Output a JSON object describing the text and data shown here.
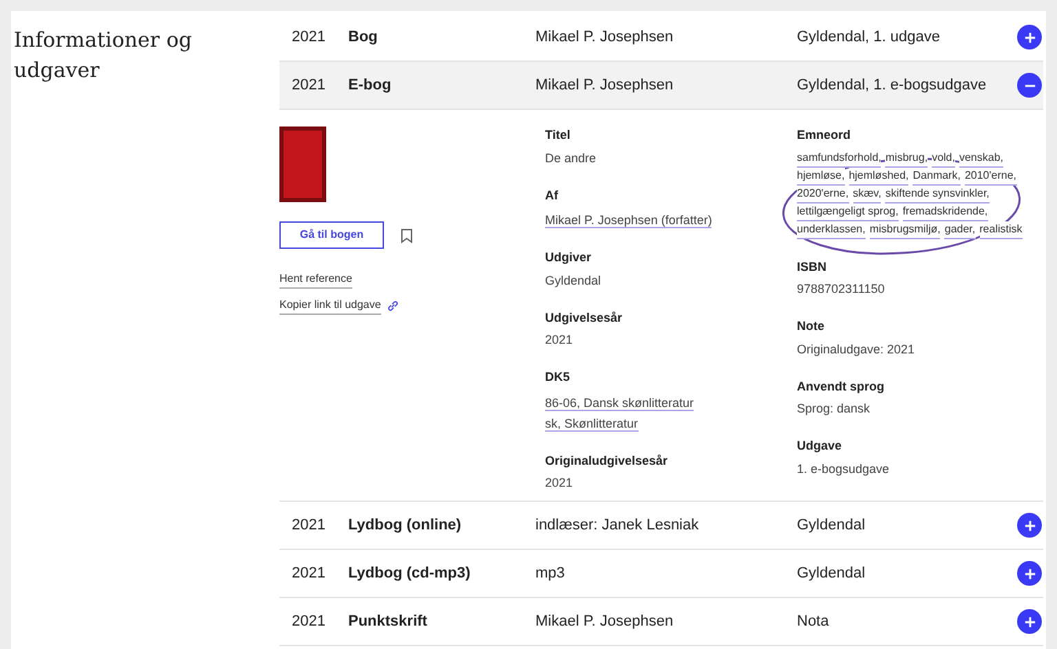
{
  "heading": "Informationer og udgaver",
  "editions": [
    {
      "year": "2021",
      "type": "Bog",
      "contributor": "Mikael P. Josephsen",
      "publisher": "Gyldendal, 1. udgave",
      "expanded": false
    },
    {
      "year": "2021",
      "type": "E-bog",
      "contributor": "Mikael P. Josephsen",
      "publisher": "Gyldendal, 1. e-bogsudgave",
      "expanded": true
    },
    {
      "year": "2021",
      "type": "Lydbog (online)",
      "contributor": "indlæser: Janek Lesniak",
      "publisher": "Gyldendal",
      "expanded": false
    },
    {
      "year": "2021",
      "type": "Lydbog (cd-mp3)",
      "contributor": "mp3",
      "publisher": "Gyldendal",
      "expanded": false
    },
    {
      "year": "2021",
      "type": "Punktskrift",
      "contributor": "Mikael P. Josephsen",
      "publisher": "Nota",
      "expanded": false
    }
  ],
  "detail": {
    "primary_button": "Gå til bogen",
    "links": [
      {
        "label": "Hent reference",
        "kind": "plain"
      },
      {
        "label": "Kopier link til udgave",
        "kind": "copy"
      }
    ],
    "fields_middle": [
      {
        "label": "Titel",
        "values": [
          {
            "text": "De andre",
            "link": false
          }
        ]
      },
      {
        "label": "Af",
        "values": [
          {
            "text": "Mikael P. Josephsen (forfatter)",
            "link": true
          }
        ]
      },
      {
        "label": "Udgiver",
        "values": [
          {
            "text": "Gyldendal",
            "link": false
          }
        ]
      },
      {
        "label": "Udgivelsesår",
        "values": [
          {
            "text": "2021",
            "link": false
          }
        ]
      },
      {
        "label": "DK5",
        "values": [
          {
            "text": "86-06, Dansk skønlitteratur",
            "link": true
          },
          {
            "text": "sk, Skønlitteratur",
            "link": true
          }
        ]
      },
      {
        "label": "Originaludgivelsesår",
        "values": [
          {
            "text": "2021",
            "link": false
          }
        ]
      }
    ],
    "subjects": {
      "label": "Emneord",
      "keywords": [
        "samfundsforhold,",
        "misbrug,",
        "vold,",
        "venskab,",
        "hjemløse,",
        "hjemløshed,",
        "Danmark,",
        "2010'erne,",
        "2020'erne,",
        "skæv,",
        "skiftende synsvinkler,",
        "lettilgængeligt sprog,",
        "fremadskridende,",
        "underklassen,",
        "misbrugsmiljø,",
        "gader,",
        "realistisk"
      ]
    },
    "fields_right": [
      {
        "label": "ISBN",
        "values": [
          {
            "text": "9788702311150",
            "link": false
          }
        ]
      },
      {
        "label": "Note",
        "values": [
          {
            "text": "Originaludgave: 2021",
            "link": false
          }
        ]
      },
      {
        "label": "Anvendt sprog",
        "values": [
          {
            "text": "Sprog: dansk",
            "link": false
          }
        ]
      },
      {
        "label": "Udgave",
        "values": [
          {
            "text": "1. e-bogsudgave",
            "link": false
          }
        ]
      }
    ]
  }
}
